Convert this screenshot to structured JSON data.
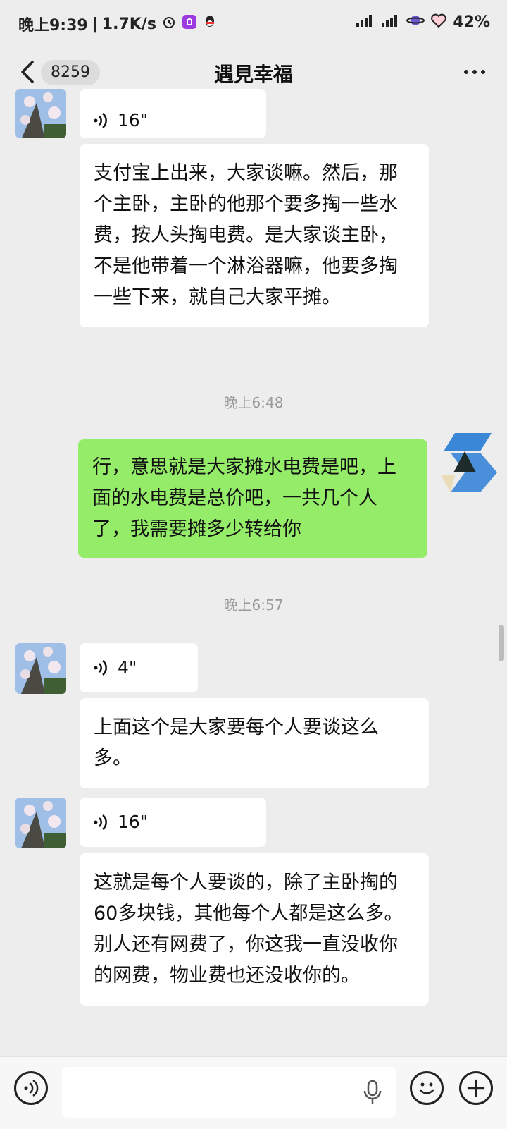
{
  "status_bar": {
    "time": "晚上9:39",
    "speed": "1.7K/s",
    "battery": "42%",
    "icons": [
      "alarm-icon",
      "notification-app-icon",
      "qq-icon",
      "signal-icon",
      "signal-icon",
      "planet-icon",
      "heart-icon"
    ]
  },
  "header": {
    "back_icon": "chevron-left-icon",
    "unread_count": "8259",
    "title": "遇見幸福",
    "more_icon": "more-dots-icon"
  },
  "messages": [
    {
      "type": "voice",
      "duration": "16\""
    },
    {
      "type": "text",
      "text": "支付宝上出来，大家谈嘛。然后，那个主卧，主卧的他那个要多掏一些水费，按人头掏电费。是大家谈主卧，不是他带着一个淋浴器嘛，他要多掏一些下来，就自己大家平摊。"
    },
    {
      "type": "timestamp",
      "text": "晚上6:48"
    },
    {
      "type": "self_text",
      "text": "行，意思就是大家摊水电费是吧，上面的水电费是总价吧，一共几个人了，我需要摊多少转给你"
    },
    {
      "type": "timestamp",
      "text": "晚上6:57"
    },
    {
      "type": "voice",
      "duration": "4\""
    },
    {
      "type": "text",
      "text": "上面这个是大家要每个人要谈这么多。"
    },
    {
      "type": "voice",
      "duration": "16\""
    },
    {
      "type": "text",
      "text": "这就是每个人要谈的，除了主卧掏的60多块钱，其他每个人都是这么多。别人还有网费了，你这我一直没收你的网费，物业费也还没收你的。"
    }
  ],
  "input_bar": {
    "voice_toggle_icon": "voice-mode-icon",
    "text_value": "",
    "mic_icon": "microphone-icon",
    "emoji_icon": "emoji-icon",
    "plus_icon": "plus-icon"
  },
  "colors": {
    "background": "#ededed",
    "self_bubble": "#95ec69",
    "other_bubble": "#ffffff",
    "timestamp_text": "#999999"
  }
}
